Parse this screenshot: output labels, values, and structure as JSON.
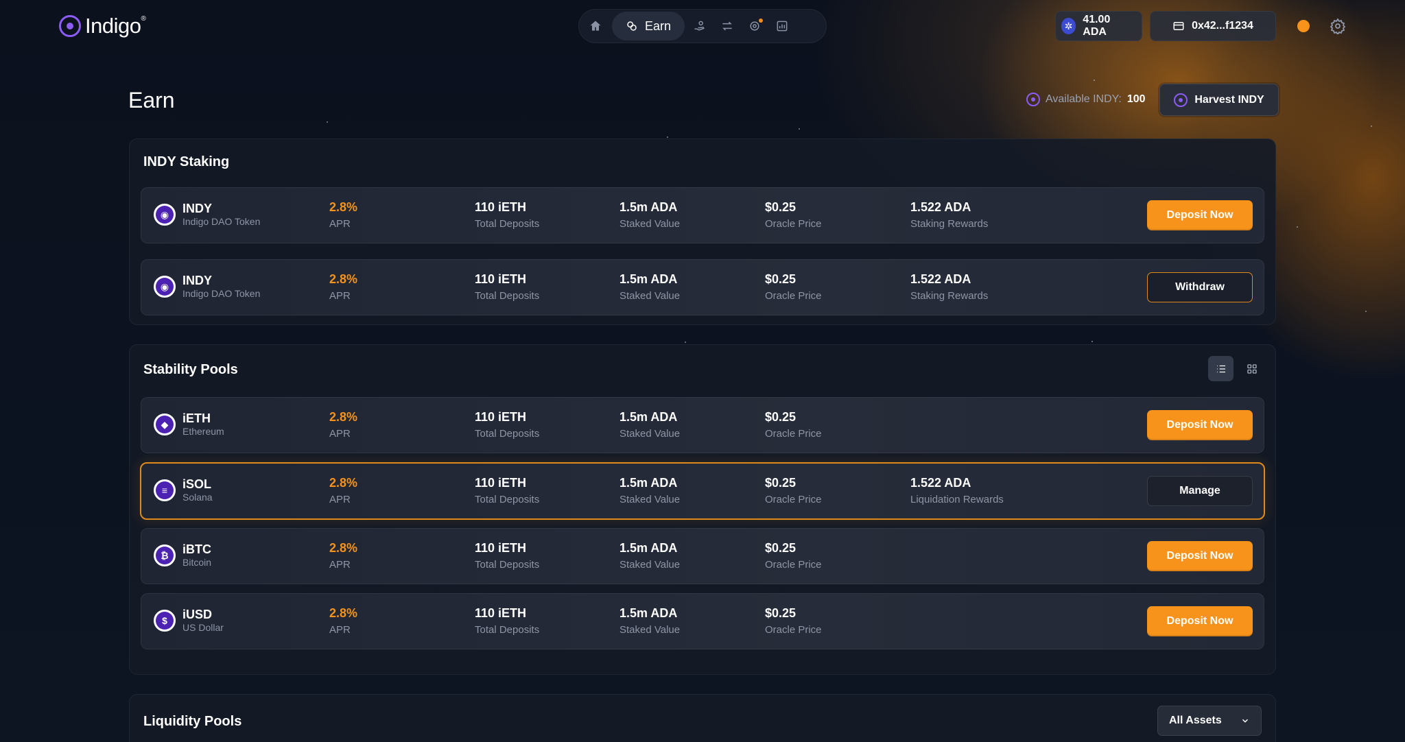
{
  "brand": {
    "name": "Indigo"
  },
  "nav": {
    "active_label": "Earn"
  },
  "header": {
    "ada_balance": "41.00 ADA",
    "wallet_address": "0x42...f1234"
  },
  "page": {
    "title": "Earn",
    "available_label": "Available INDY:",
    "available_value": "100",
    "harvest_label": "Harvest INDY"
  },
  "staking": {
    "title": "INDY Staking",
    "rows": [
      {
        "name": "INDY",
        "sub": "Indigo DAO Token",
        "apr": "2.8%",
        "apr_label": "APR",
        "deposits": "110 iETH",
        "deposits_label": "Total Deposits",
        "staked": "1.5m ADA",
        "staked_label": "Staked Value",
        "price": "$0.25",
        "price_label": "Oracle Price",
        "rewards": "1.522 ADA",
        "rewards_label": "Staking Rewards",
        "action": "Deposit Now"
      },
      {
        "name": "INDY",
        "sub": "Indigo DAO Token",
        "apr": "2.8%",
        "apr_label": "APR",
        "deposits": "110 iETH",
        "deposits_label": "Total Deposits",
        "staked": "1.5m ADA",
        "staked_label": "Staked Value",
        "price": "$0.25",
        "price_label": "Oracle Price",
        "rewards": "1.522 ADA",
        "rewards_label": "Staking Rewards",
        "action": "Withdraw"
      }
    ]
  },
  "stability": {
    "title": "Stability Pools",
    "rows": [
      {
        "name": "iETH",
        "sub": "Ethereum",
        "icon": "ethereum-icon",
        "apr": "2.8%",
        "apr_label": "APR",
        "deposits": "110 iETH",
        "deposits_label": "Total Deposits",
        "staked": "1.5m ADA",
        "staked_label": "Staked Value",
        "price": "$0.25",
        "price_label": "Oracle Price",
        "action": "Deposit Now"
      },
      {
        "name": "iSOL",
        "sub": "Solana",
        "icon": "solana-icon",
        "apr": "2.8%",
        "apr_label": "APR",
        "deposits": "110 iETH",
        "deposits_label": "Total Deposits",
        "staked": "1.5m ADA",
        "staked_label": "Staked Value",
        "price": "$0.25",
        "price_label": "Oracle Price",
        "rewards": "1.522 ADA",
        "rewards_label": "Liquidation Rewards",
        "action": "Manage"
      },
      {
        "name": "iBTC",
        "sub": "Bitcoin",
        "icon": "bitcoin-icon",
        "apr": "2.8%",
        "apr_label": "APR",
        "deposits": "110 iETH",
        "deposits_label": "Total Deposits",
        "staked": "1.5m ADA",
        "staked_label": "Staked Value",
        "price": "$0.25",
        "price_label": "Oracle Price",
        "action": "Deposit Now"
      },
      {
        "name": "iUSD",
        "sub": "US Dollar",
        "icon": "dollar-icon",
        "apr": "2.8%",
        "apr_label": "APR",
        "deposits": "110 iETH",
        "deposits_label": "Total Deposits",
        "staked": "1.5m ADA",
        "staked_label": "Staked Value",
        "price": "$0.25",
        "price_label": "Oracle Price",
        "action": "Deposit Now"
      }
    ]
  },
  "liquidity": {
    "title": "Liquidity Pools",
    "filter_label": "All Assets"
  },
  "colors": {
    "accent": "#f7931a",
    "indigo": "#8b5cf6",
    "background": "#0c1220"
  }
}
